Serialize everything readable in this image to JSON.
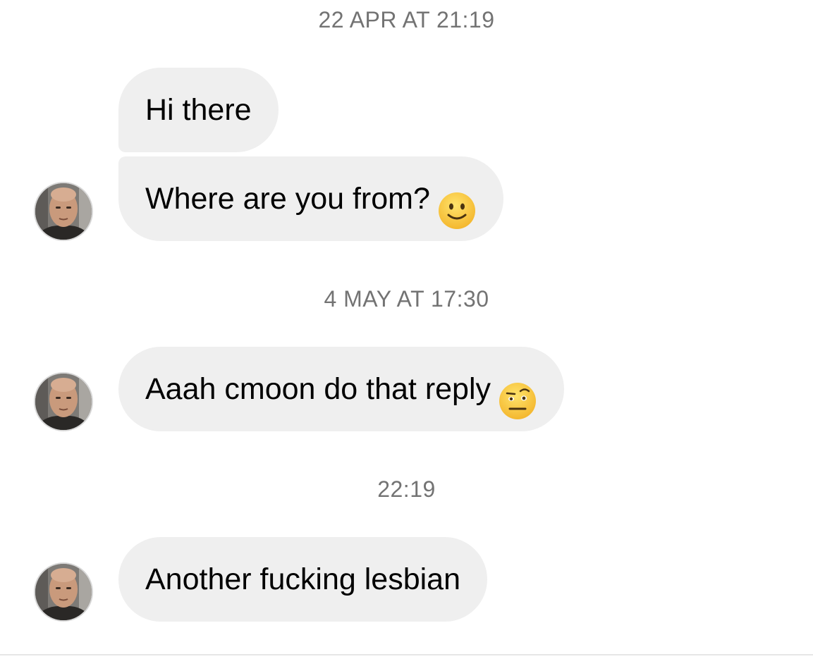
{
  "conversation": {
    "timestamps": [
      "22 APR AT 21:19",
      "4 MAY AT 17:30",
      "22:19"
    ],
    "messages": [
      {
        "text": "Hi there",
        "emoji_icon": null
      },
      {
        "text": "Where are you from?",
        "emoji_icon": "slightly-smiling-face-icon"
      },
      {
        "text": "Aaah cmoon do that reply",
        "emoji_icon": "face-with-raised-eyebrow-icon"
      },
      {
        "text": "Another fucking lesbian",
        "emoji_icon": null
      }
    ]
  },
  "colors": {
    "bubble_background": "#efefef",
    "timestamp_text": "#737373",
    "message_text": "#000000",
    "emoji_yellow": "#f7c12f"
  }
}
